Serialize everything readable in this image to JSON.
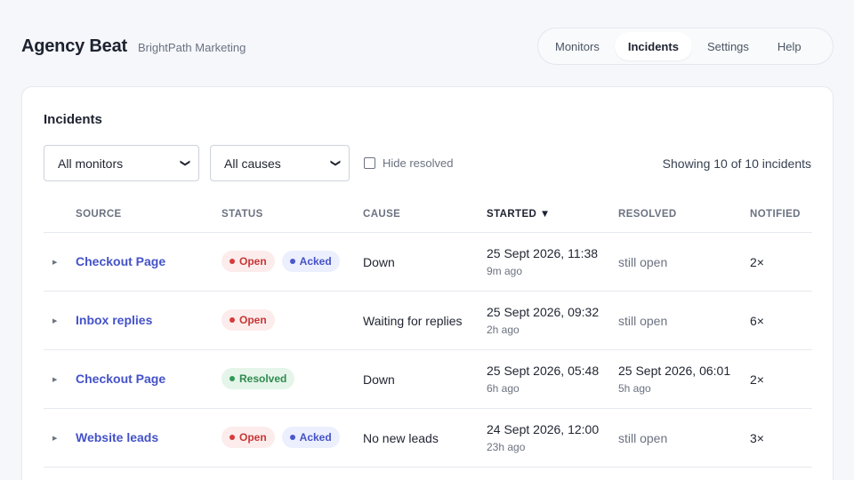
{
  "app": {
    "title": "Agency Beat",
    "subtitle": "BrightPath Marketing"
  },
  "nav": {
    "tabs": [
      {
        "label": "Monitors",
        "active": false
      },
      {
        "label": "Incidents",
        "active": true
      },
      {
        "label": "Settings",
        "active": false
      },
      {
        "label": "Help",
        "active": false
      }
    ]
  },
  "incidents": {
    "title": "Incidents",
    "filters": {
      "monitor_select": "All monitors",
      "cause_select": "All causes",
      "hide_resolved_label": "Hide resolved",
      "hide_resolved_checked": false
    },
    "showing_text": "Showing 10 of 10 incidents",
    "columns": {
      "source": "Source",
      "status": "Status",
      "cause": "Cause",
      "started": "Started",
      "resolved": "Resolved",
      "notified": "Notified"
    },
    "sort_indicator": "▼",
    "rows": [
      {
        "source": "Checkout Page",
        "badges": [
          {
            "label": "Open",
            "kind": "open"
          },
          {
            "label": "Acked",
            "kind": "acked"
          }
        ],
        "cause": "Down",
        "started": "25 Sept 2026, 11:38",
        "started_ago": "9m ago",
        "resolved": "still open",
        "resolved_ago": "",
        "notified": "2×"
      },
      {
        "source": "Inbox replies",
        "badges": [
          {
            "label": "Open",
            "kind": "open"
          }
        ],
        "cause": "Waiting for replies",
        "started": "25 Sept 2026, 09:32",
        "started_ago": "2h ago",
        "resolved": "still open",
        "resolved_ago": "",
        "notified": "6×"
      },
      {
        "source": "Checkout Page",
        "badges": [
          {
            "label": "Resolved",
            "kind": "resolved"
          }
        ],
        "cause": "Down",
        "started": "25 Sept 2026, 05:48",
        "started_ago": "6h ago",
        "resolved": "25 Sept 2026, 06:01",
        "resolved_ago": "5h ago",
        "notified": "2×"
      },
      {
        "source": "Website leads",
        "badges": [
          {
            "label": "Open",
            "kind": "open"
          },
          {
            "label": "Acked",
            "kind": "acked"
          }
        ],
        "cause": "No new leads",
        "started": "24 Sept 2026, 12:00",
        "started_ago": "23h ago",
        "resolved": "still open",
        "resolved_ago": "",
        "notified": "3×"
      }
    ]
  },
  "colors": {
    "accent": "#4452c8",
    "open": "#c63636",
    "acked": "#4452c8",
    "resolved": "#2f8a4e"
  },
  "icons": {
    "row_expander": "triangle-right-icon",
    "select_chevron": "chevron-down-icon",
    "sort_arrow": "sort-desc-icon"
  }
}
